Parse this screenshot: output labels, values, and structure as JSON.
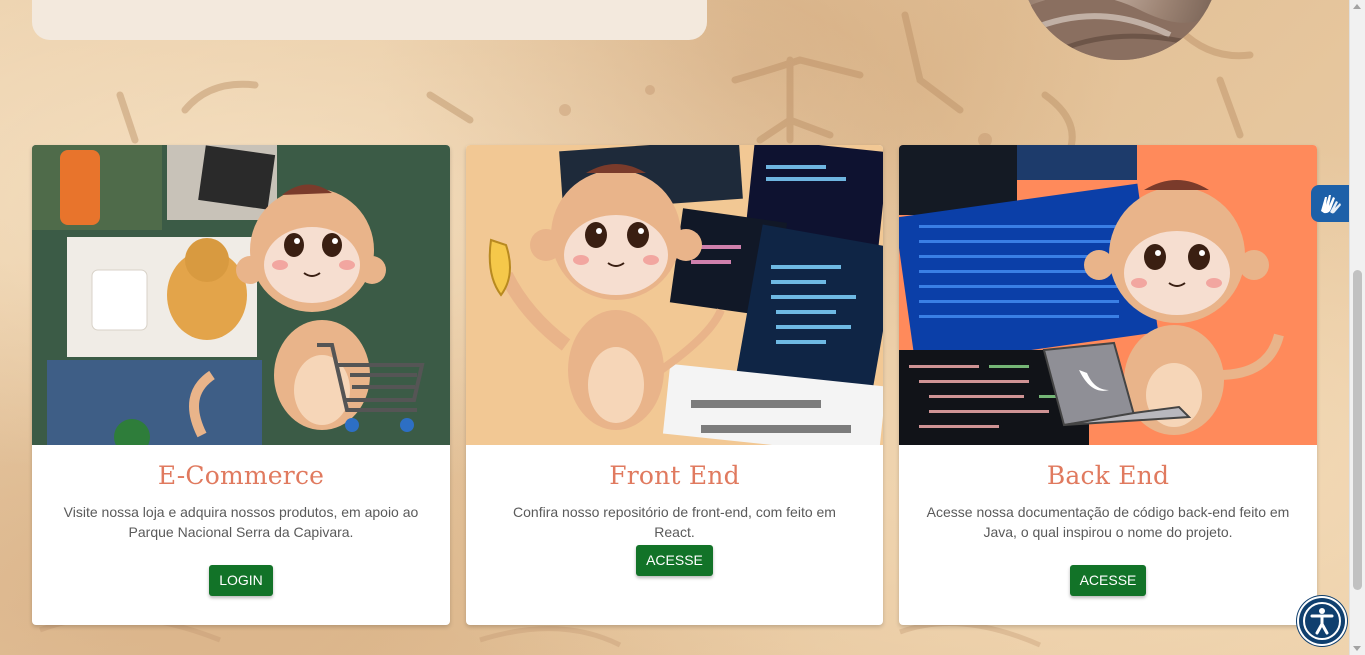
{
  "cards": [
    {
      "title": "E-Commerce",
      "description": "Visite nossa loja e adquira nossos produtos, em apoio ao Parque Nacional Serra da Capivara.",
      "button_label": "LOGIN",
      "image_icon": "monkey-shopping-cart-illustration"
    },
    {
      "title": "Front End",
      "description": "Confira nosso repositório de front-end, com feito em React.",
      "button_label": "ACESSE",
      "image_icon": "monkey-banana-code-illustration"
    },
    {
      "title": "Back End",
      "description": "Acesse nossa documentação de código back-end feito em Java, o qual inspirou o nome do projeto.",
      "button_label": "ACESSE",
      "image_icon": "monkey-laptop-java-illustration"
    }
  ],
  "widgets": {
    "vlibras_icon": "sign-language-hands-icon",
    "accessibility_icon": "accessibility-person-icon"
  },
  "colors": {
    "card_title": "#e07a5f",
    "button_bg": "#127328",
    "ecommerce_bg": "#3b5b46",
    "frontend_bg": "#f2c894",
    "backend_bg": "#ff8a5b",
    "vlibras_bg": "#1d60a8",
    "accessibility_bg": "#0f3f6e"
  }
}
